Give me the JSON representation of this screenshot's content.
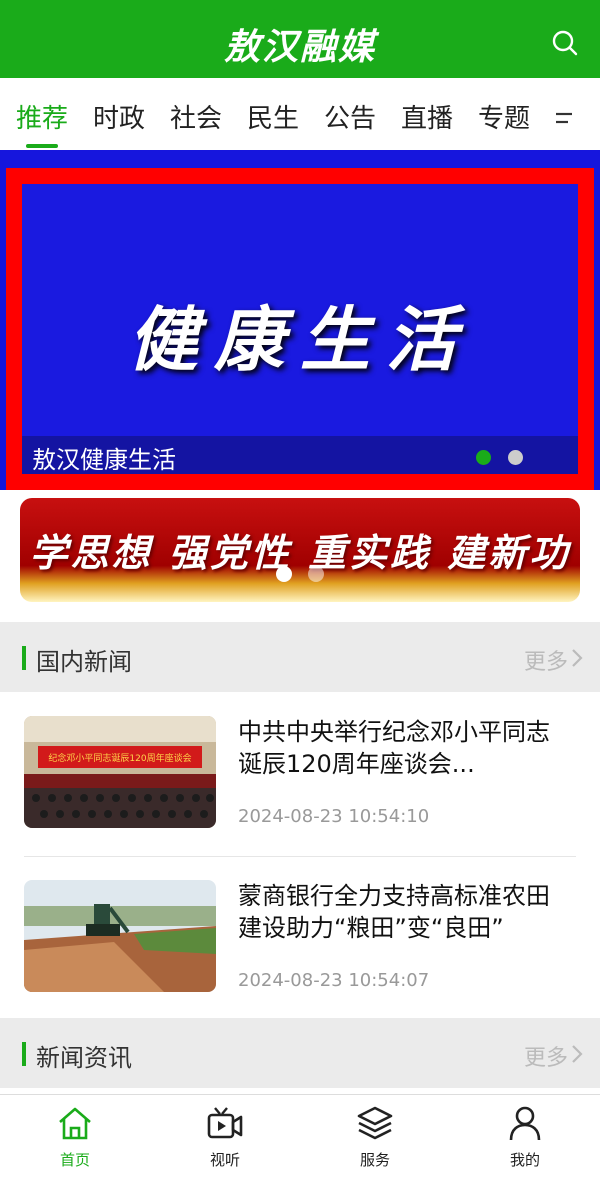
{
  "app": {
    "logo_text": "敖汉融媒"
  },
  "tabs": [
    {
      "label": "推荐",
      "active": true
    },
    {
      "label": "时政"
    },
    {
      "label": "社会"
    },
    {
      "label": "民生"
    },
    {
      "label": "公告"
    },
    {
      "label": "直播"
    },
    {
      "label": "专题"
    }
  ],
  "hero": {
    "art_text": "健康生活",
    "caption": "敖汉健康生活",
    "slide_index": 1,
    "slide_count": 2
  },
  "banner": {
    "slogan": "学思想 强党性 重实践 建新功",
    "slide_index": 1,
    "slide_count": 2
  },
  "sections": {
    "domestic": {
      "title": "国内新闻",
      "more": "更多"
    },
    "news": {
      "title": "新闻资讯",
      "more": "更多"
    }
  },
  "news_items": [
    {
      "title": "中共中央举行纪念邓小平同志诞辰120周年座谈会...",
      "time": "2024-08-23 10:54:10",
      "thumb_banner_text": "纪念邓小平同志诞辰120周年座谈会"
    },
    {
      "title": "蒙商银行全力支持高标准农田建设助力“粮田”变“良田”",
      "time": "2024-08-23 10:54:07"
    }
  ],
  "bottom_nav": [
    {
      "label": "首页",
      "icon": "home-icon",
      "active": true
    },
    {
      "label": "视听",
      "icon": "video-icon"
    },
    {
      "label": "服务",
      "icon": "layers-icon"
    },
    {
      "label": "我的",
      "icon": "user-icon"
    }
  ],
  "colors": {
    "brand_green": "#1aab1a",
    "hero_blue": "#1616dd",
    "hero_border_red": "#ff0000"
  }
}
